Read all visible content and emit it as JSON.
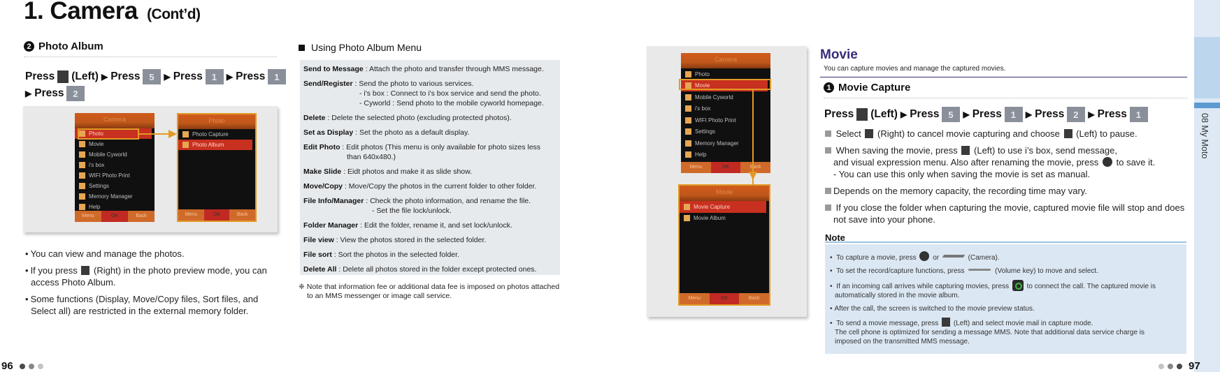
{
  "page": {
    "title": "1. Camera",
    "title_suffix": "(Cont’d)"
  },
  "photo_album": {
    "number": "2",
    "heading": "Photo Album",
    "press_word": "Press",
    "left_label": "(Left)",
    "keys": [
      "5",
      "1",
      "1",
      "2"
    ],
    "screens": {
      "camera_menu": {
        "title": "Camera",
        "items": [
          "Photo",
          "Movie",
          "Mobile Cyworld",
          "i's box",
          "WIFI Photo Print",
          "Settings",
          "Memory Manager",
          "Help"
        ],
        "selected_index": 0,
        "footer": [
          "Menu",
          "OK",
          "Back"
        ]
      },
      "photo_menu": {
        "title": "Photo",
        "items": [
          "Photo Capture",
          "Photo Album"
        ],
        "selected_index": 1,
        "footer": [
          "Menu",
          "OK",
          "Back"
        ]
      }
    },
    "bullets": [
      "You can view and manage the photos.",
      "If you press",
      "(Right) in the photo preview mode, you can access Photo Album.",
      "Some functions (Display, Move/Copy files, Sort files, and Select all) are restricted in the external memory folder."
    ]
  },
  "menu_section": {
    "heading": "Using Photo Album Menu",
    "items": [
      {
        "term": "Send to Message",
        "desc": " : Attach the photo and transfer through MMS message."
      },
      {
        "term": "Send/Register",
        "desc": " : Send the photo to various services.",
        "sub": [
          "- i's box : Connect to i's box service and send the photo.",
          "- Cyworld : Send photo to the mobile cyworld homepage."
        ]
      },
      {
        "term": "Delete",
        "desc": " : Delete the selected photo (excluding protected photos)."
      },
      {
        "term": "Set as Display",
        "desc": " : Set the photo as a default display."
      },
      {
        "term": "Edit Photo",
        "desc": " : Edit photos (This menu is only available for photo sizes less",
        "sub": [
          "than 640x480.)"
        ]
      },
      {
        "term": "Make Slide",
        "desc": " : Eidt photos and make it as slide show."
      },
      {
        "term": "Move/Copy",
        "desc": " : Move/Copy the photos in the current folder to other folder."
      },
      {
        "term": "File Info/Manager",
        "desc": " : Check the photo information, and rename the file.",
        "sub": [
          "- Set the file lock/unlock."
        ]
      },
      {
        "term": "Folder Manager",
        "desc": " : Edit the folder, rename it, and set lock/unlock."
      },
      {
        "term": "File view",
        "desc": " : View the photos stored in the selected folder."
      },
      {
        "term": "File sort",
        "desc": " : Sort the photos in the selected folder."
      },
      {
        "term": "Delete All",
        "desc": " : Delete all photos stored in the folder except protected ones."
      }
    ],
    "footnote_mark": "❈",
    "footnote": "Note that information fee or additional data fee is imposed on photos attached",
    "footnote_2": "to an MMS messenger or image call service."
  },
  "movie": {
    "title": "Movie",
    "subtitle": "You can capture movies and manage the captured movies.",
    "capture": {
      "number": "1",
      "heading": "Movie Capture",
      "press_word": "Press",
      "left_label": "(Left)",
      "keys": [
        "5",
        "1",
        "2",
        "1"
      ]
    },
    "screens": {
      "camera_menu": {
        "title": "Camera",
        "items": [
          "Photo",
          "Movie",
          "Mobile Cyworld",
          "i's box",
          "WIFI Photo Print",
          "Settings",
          "Memory Manager",
          "Help"
        ],
        "selected_index": 1,
        "footer": [
          "Menu",
          "OK",
          "Back"
        ]
      },
      "movie_menu": {
        "title": "Movie",
        "items": [
          "Movie Capture",
          "Movie Album"
        ],
        "selected_index": 0,
        "footer": [
          "Menu",
          "OK",
          "Back"
        ]
      }
    },
    "items": {
      "i1a": "Select",
      "i1b": "(Right) to cancel movie capturing and choose",
      "i1c": "(Left) to pause.",
      "i2a": "When saving the movie, press",
      "i2b": "(Left) to use i’s box, send message,",
      "i2c": "and visual expression menu. Also after renaming the movie, press",
      "i2d": "to save it.",
      "i2e": "- You can use this only when saving the movie is set as manual.",
      "i3": "Depends on the memory capacity, the recording time may vary.",
      "i4a": "If you close the folder when capturing the movie, captured movie file will stop and does",
      "i4b": "not save into your phone."
    },
    "note": {
      "label": "Note",
      "n1a": "To capture a movie, press",
      "n1b": "or",
      "n1c": "(Camera).",
      "n2a": "To set the record/capture functions, press",
      "n2b": "(Volume key) to move and select.",
      "n3a": "If an incoming call arrives while capturing movies, press",
      "n3b": "to connect the call. The captured movie is",
      "n3c": "automatically stored in the movie album.",
      "n4": "After the call, the screen is switched to the movie preview status.",
      "n5a": "To send a movie message, press",
      "n5b": "(Left) and select movie mail in capture mode.",
      "n5c": "The cell phone is optimized for sending a message MMS. Note that additional data service charge is",
      "n5d": "imposed on the transmitted MMS message."
    }
  },
  "side_tab": {
    "label": "08 My Moto"
  },
  "pagination": {
    "left_page": "96",
    "right_page": "97"
  },
  "colors": {
    "movie_accent": "#3a2d7a",
    "note_bg": "#dbe7f3",
    "highlight": "#e39a25",
    "tab_accent": "#5c9ad3"
  }
}
